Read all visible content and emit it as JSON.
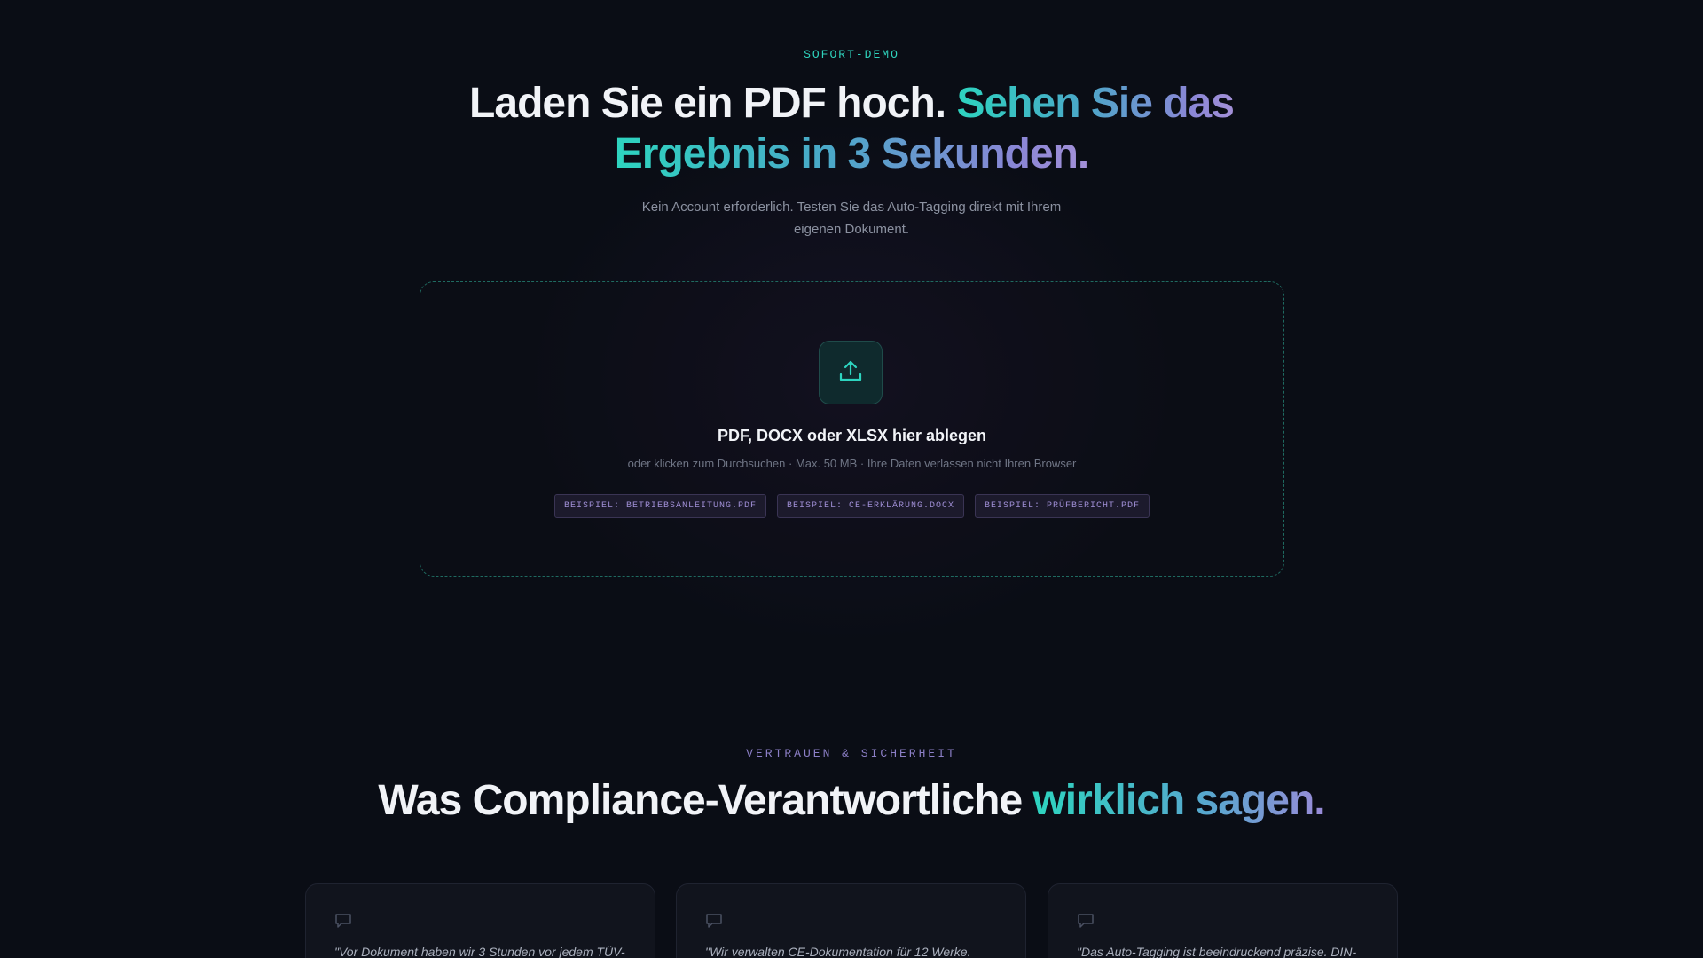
{
  "demo": {
    "eyebrow": "SOFORT-DEMO",
    "title_part1": "Laden Sie ein PDF hoch. ",
    "title_accent_line1": "Sehen Sie das",
    "title_accent_line2": "Ergebnis in 3 Sekunden.",
    "subtitle": "Kein Account erforderlich. Testen Sie das Auto-Tagging direkt mit Ihrem eigenen Dokument.",
    "dropzone": {
      "icon": "upload-icon",
      "title": "PDF, DOCX oder XLSX hier ablegen",
      "hint": "oder klicken zum Durchsuchen · Max. 50 MB · Ihre Daten verlassen nicht Ihren Browser",
      "samples": [
        "BEISPIEL: BETRIEBSANLEITUNG.PDF",
        "BEISPIEL: CE-ERKLÄRUNG.DOCX",
        "BEISPIEL: PRÜFBERICHT.PDF"
      ]
    }
  },
  "trust": {
    "eyebrow": "VERTRAUEN & SICHERHEIT",
    "title_part1": "Was Compliance-Verantwortliche ",
    "title_accent": "wirklich sagen.",
    "testimonials": [
      {
        "icon": "speech-bubble-icon",
        "quote": "\"Vor Dokument haben wir 3 Stunden vor jedem TÜV-"
      },
      {
        "icon": "speech-bubble-icon",
        "quote": "\"Wir verwalten CE-Dokumentation für 12 Werke."
      },
      {
        "icon": "speech-bubble-icon",
        "quote": "\"Das Auto-Tagging ist beeindruckend präzise. DIN-"
      }
    ]
  },
  "colors": {
    "background": "#0a0d15",
    "accent_teal": "#2dd4bf",
    "accent_purple": "#9a8bd8"
  }
}
